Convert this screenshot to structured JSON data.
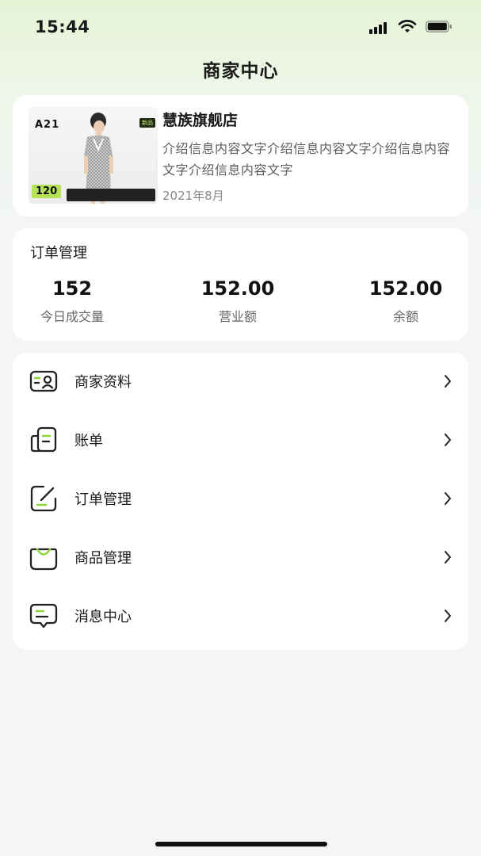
{
  "status_bar": {
    "time": "15:44"
  },
  "header": {
    "title": "商家中心"
  },
  "store": {
    "name": "慧族旗舰店",
    "description": "介绍信息内容文字介绍信息内容文字介绍信息内容文字介绍信息内容文字",
    "date": "2021年8月",
    "thumbnail": {
      "brand": "A21",
      "badge": "新品",
      "price": "120"
    }
  },
  "orders": {
    "title": "订单管理",
    "stats": [
      {
        "value": "152",
        "label": "今日成交量"
      },
      {
        "value": "152.00",
        "label": "营业额"
      },
      {
        "value": "152.00",
        "label": "余额"
      }
    ]
  },
  "menu": {
    "items": [
      {
        "label": "商家资料",
        "icon": "merchant-profile-icon"
      },
      {
        "label": "账单",
        "icon": "bill-icon"
      },
      {
        "label": "订单管理",
        "icon": "order-edit-icon"
      },
      {
        "label": "商品管理",
        "icon": "shopping-bag-icon"
      },
      {
        "label": "消息中心",
        "icon": "message-icon"
      }
    ]
  },
  "colors": {
    "accent": "#8fd43c",
    "background": "#f3f5f7",
    "card": "#ffffff"
  }
}
